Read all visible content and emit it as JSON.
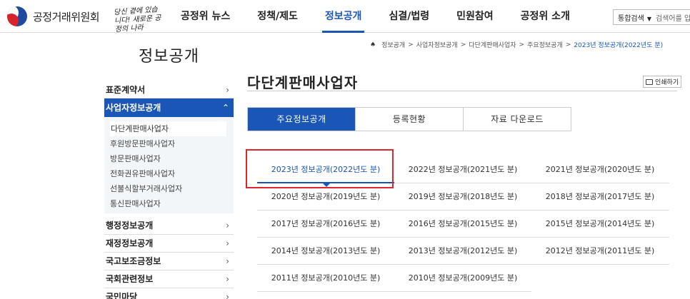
{
  "header": {
    "logo_text": "공정거래위원회",
    "slogan": "당신 곁에 있습니다! 새로운 공정의 나라",
    "nav": [
      "공정위 뉴스",
      "정책/제도",
      "정보공개",
      "심결/법령",
      "민원참여",
      "공정위 소개"
    ],
    "active_nav": "정보공개",
    "search": {
      "select_label": "통합검색",
      "placeholder": "검색어를 입"
    }
  },
  "sidebar": {
    "title": "정보공개",
    "items": [
      {
        "label": "표준계약서",
        "chevron": "›"
      },
      {
        "label": "사업자정보공개",
        "chevron": "⌃"
      },
      {
        "label": "행정정보공개",
        "chevron": "›"
      },
      {
        "label": "재정정보공개",
        "chevron": "›"
      },
      {
        "label": "국고보조금정보",
        "chevron": "›"
      },
      {
        "label": "국회관련정보",
        "chevron": "›"
      },
      {
        "label": "국민마당",
        "chevron": "›"
      }
    ],
    "sub_items": [
      "다단계판매사업자",
      "후원방문판매사업자",
      "방문판매사업자",
      "전화권유판매사업자",
      "선불식할부거래사업자",
      "통신판매사업자"
    ]
  },
  "breadcrumb": {
    "items": [
      "정보공개",
      "사업자정보공개",
      "다단계판매사업자",
      "주요정보공개"
    ],
    "current": "2023년 정보공개(2022년도 분)",
    "separator": ">"
  },
  "main": {
    "title": "다단계판매사업자",
    "print_label": "인쇄하기",
    "tabs": [
      "주요정보공개",
      "등록현황",
      "자료 다운로드"
    ],
    "years": [
      [
        "2023년 정보공개(2022년도 분)",
        "2022년 정보공개(2021년도 분)",
        "2021년 정보공개(2020년도 분)"
      ],
      [
        "2020년 정보공개(2019년도 분)",
        "2019년 정보공개(2018년도 분)",
        "2018년 정보공개(2017년도 분)"
      ],
      [
        "2017년 정보공개(2016년도 분)",
        "2016년 정보공개(2015년도 분)",
        "2015년 정보공개(2014년도 분)"
      ],
      [
        "2014년 정보공개(2013년도 분)",
        "2013년 정보공개(2012년도 분)",
        "2012년 정보공개(2011년도 분)"
      ],
      [
        "2011년 정보공개(2010년도 분)",
        "2010년 정보공개(2009년도 분)"
      ]
    ]
  },
  "colors": {
    "accent": "#1a56b6",
    "highlight": "#e0262d",
    "sub_bg": "#f2f6f9"
  }
}
